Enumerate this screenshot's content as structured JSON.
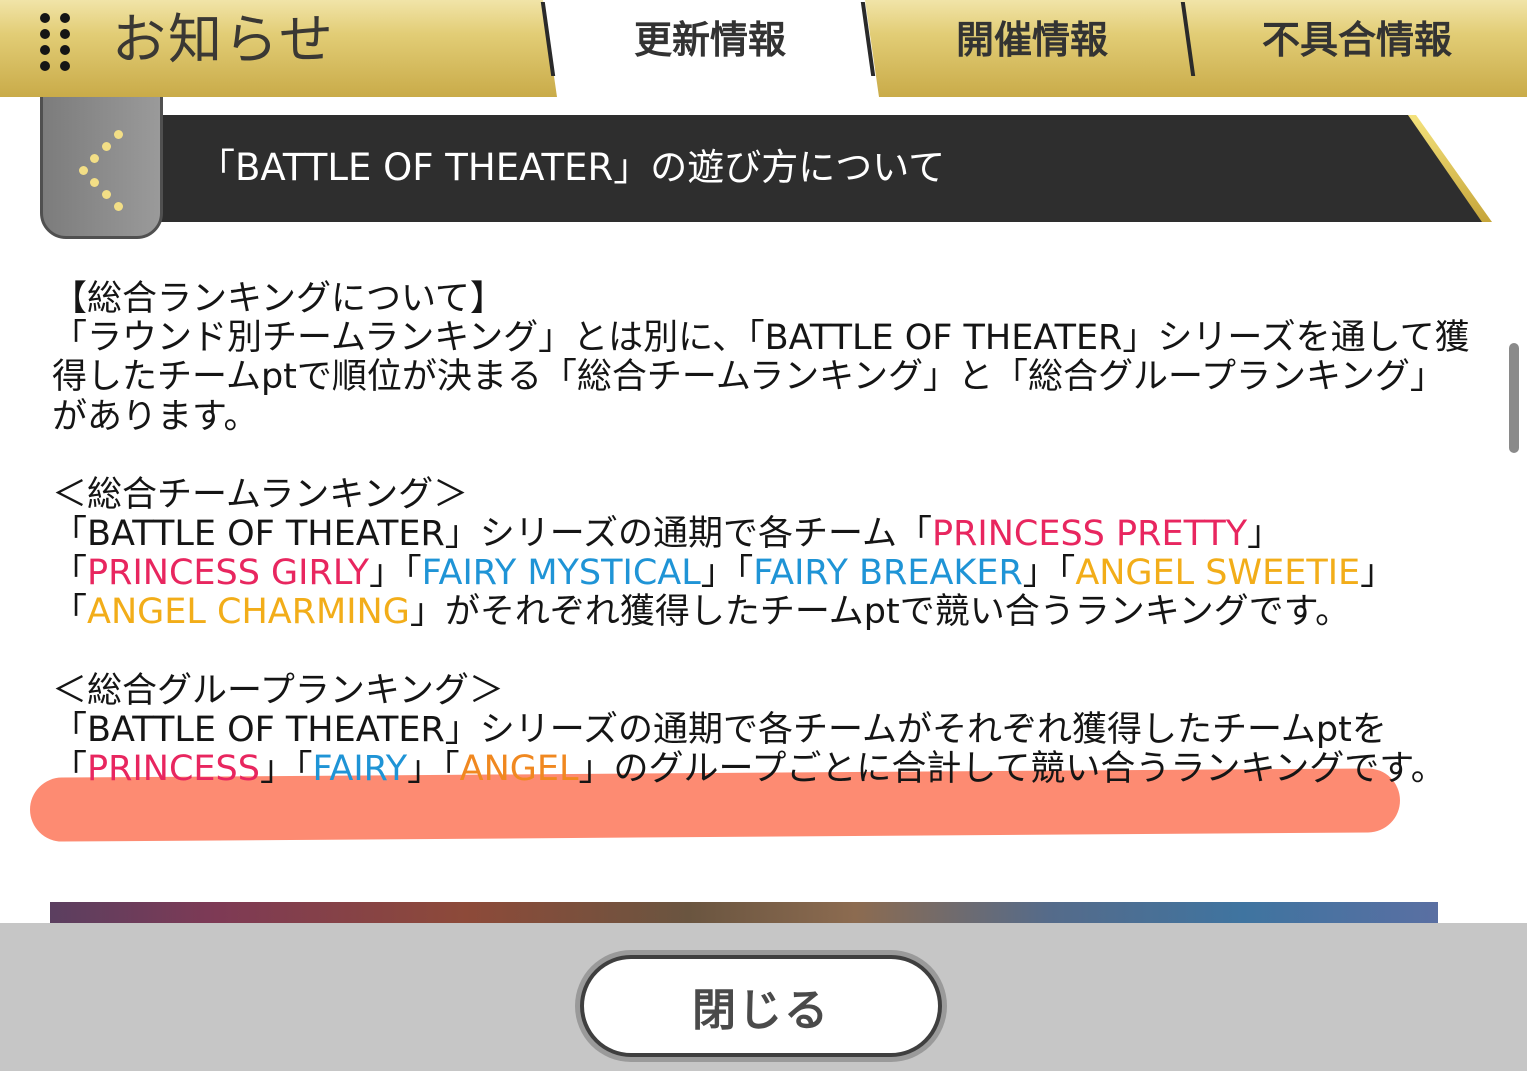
{
  "header": {
    "title": "お知らせ",
    "tabs": [
      {
        "label": "更新情報",
        "active": true
      },
      {
        "label": "開催情報",
        "active": false
      },
      {
        "label": "不具合情報",
        "active": false
      }
    ]
  },
  "article": {
    "title": "「BATTLE OF THEATER」の遊び方について",
    "overall_heading": "【総合ランキングについて】",
    "overall_body": "「ラウンド別チームランキング」とは別に、「BATTLE OF THEATER」シリーズを通して獲得したチームptで順位が決まる「総合チームランキング」と「総合グループランキング」があります。",
    "team_heading": "＜総合チームランキング＞",
    "team_intro": "「BATTLE OF THEATER」シリーズの通期で各チーム「",
    "team_names": {
      "princess_pretty": "PRINCESS PRETTY",
      "princess_girly": "PRINCESS GIRLY",
      "fairy_mystical": "FAIRY MYSTICAL",
      "fairy_breaker": "FAIRY BREAKER",
      "angel_sweetie": "ANGEL SWEETIE",
      "angel_charming": "ANGEL CHARMING"
    },
    "team_outro": "」がそれぞれ獲得したチームptで競い合うランキングです。",
    "group_heading": "＜総合グループランキング＞",
    "group_intro": "「BATTLE OF THEATER」シリーズの通期で各チームがそれぞれ獲得したチームptを",
    "group_names": {
      "princess": "PRINCESS",
      "fairy": "FAIRY",
      "angel": "ANGEL"
    },
    "group_outro": "」のグループごとに合計して競い合うランキングです。"
  },
  "footer": {
    "close_label": "閉じる"
  },
  "colors": {
    "princess": "#e8265f",
    "fairy": "#1f94d6",
    "angel_team": "#f2ad19",
    "angel_group": "#f08820",
    "highlight": "#fc5e3c",
    "header_gold": "#d7bd5e"
  },
  "icons": {
    "menu": "menu-dots-icon",
    "back": "chevron-left-icon"
  }
}
